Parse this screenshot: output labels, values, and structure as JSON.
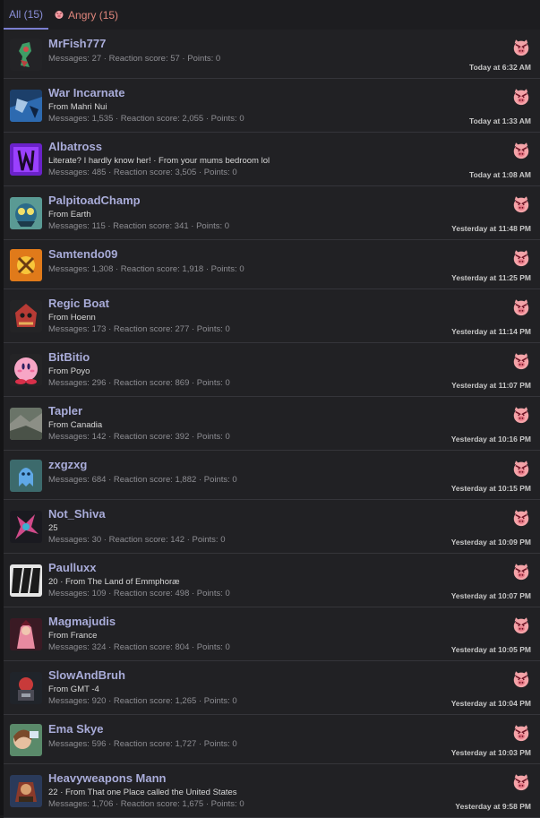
{
  "tabs": [
    {
      "label": "All (15)"
    },
    {
      "label": "Angry (15)"
    }
  ],
  "reaction_icon": "angry-pig-icon",
  "colors": {
    "accent": "#7b7fd0",
    "angry": "#e0867c",
    "username": "#a9acd9"
  },
  "reactions": [
    {
      "name": "MrFish777",
      "blurb": "",
      "stats": "Messages: 27 · Reaction score: 57 · Points: 0",
      "time": "Today at 6:32 AM",
      "avatar": "fish-avatar"
    },
    {
      "name": "War Incarnate",
      "blurb": "From Mahri Nui",
      "stats": "Messages: 1,535 · Reaction score: 2,055 · Points: 0",
      "time": "Today at 1:33 AM",
      "avatar": "war-avatar"
    },
    {
      "name": "Albatross",
      "blurb": "Literate? I hardly know her! · From your mums bedroom lol",
      "stats": "Messages: 485 · Reaction score: 3,505 · Points: 0",
      "time": "Today at 1:08 AM",
      "avatar": "purple-avatar"
    },
    {
      "name": "PalpitoadChamp",
      "blurb": "From Earth",
      "stats": "Messages: 115 · Reaction score: 341 · Points: 0",
      "time": "Yesterday at 11:48 PM",
      "avatar": "palpitoad-avatar"
    },
    {
      "name": "Samtendo09",
      "blurb": "",
      "stats": "Messages: 1,308 · Reaction score: 1,918 · Points: 0",
      "time": "Yesterday at 11:25 PM",
      "avatar": "orange-avatar"
    },
    {
      "name": "Regic Boat",
      "blurb": "From Hoenn",
      "stats": "Messages: 173 · Reaction score: 277 · Points: 0",
      "time": "Yesterday at 11:14 PM",
      "avatar": "red-avatar"
    },
    {
      "name": "BitBitio",
      "blurb": "From Poyo",
      "stats": "Messages: 296 · Reaction score: 869 · Points: 0",
      "time": "Yesterday at 11:07 PM",
      "avatar": "kirby-avatar"
    },
    {
      "name": "Tapler",
      "blurb": "From Canadia",
      "stats": "Messages: 142 · Reaction score: 392 · Points: 0",
      "time": "Yesterday at 10:16 PM",
      "avatar": "landscape-avatar"
    },
    {
      "name": "zxgzxg",
      "blurb": "",
      "stats": "Messages: 684 · Reaction score: 1,882 · Points: 0",
      "time": "Yesterday at 10:15 PM",
      "avatar": "blob-avatar"
    },
    {
      "name": "Not_Shiva",
      "blurb": "25",
      "stats": "Messages: 30 · Reaction score: 142 · Points: 0",
      "time": "Yesterday at 10:09 PM",
      "avatar": "shiva-avatar"
    },
    {
      "name": "Paulluxx",
      "blurb": "20 · From The Land of Emmphoræ",
      "stats": "Messages: 109 · Reaction score: 498 · Points: 0",
      "time": "Yesterday at 10:07 PM",
      "avatar": "paulluxx-avatar"
    },
    {
      "name": "Magmajudis",
      "blurb": "From France",
      "stats": "Messages: 324 · Reaction score: 804 · Points: 0",
      "time": "Yesterday at 10:05 PM",
      "avatar": "magma-avatar"
    },
    {
      "name": "SlowAndBruh",
      "blurb": "From GMT -4",
      "stats": "Messages: 920 · Reaction score: 1,265 · Points: 0",
      "time": "Yesterday at 10:04 PM",
      "avatar": "slow-avatar"
    },
    {
      "name": "Ema Skye",
      "blurb": "",
      "stats": "Messages: 596 · Reaction score: 1,727 · Points: 0",
      "time": "Yesterday at 10:03 PM",
      "avatar": "ema-avatar"
    },
    {
      "name": "Heavyweapons Mann",
      "blurb": "22 · From That one Place called the United States",
      "stats": "Messages: 1,706 · Reaction score: 1,675 · Points: 0",
      "time": "Yesterday at 9:58 PM",
      "avatar": "heavy-avatar"
    }
  ]
}
